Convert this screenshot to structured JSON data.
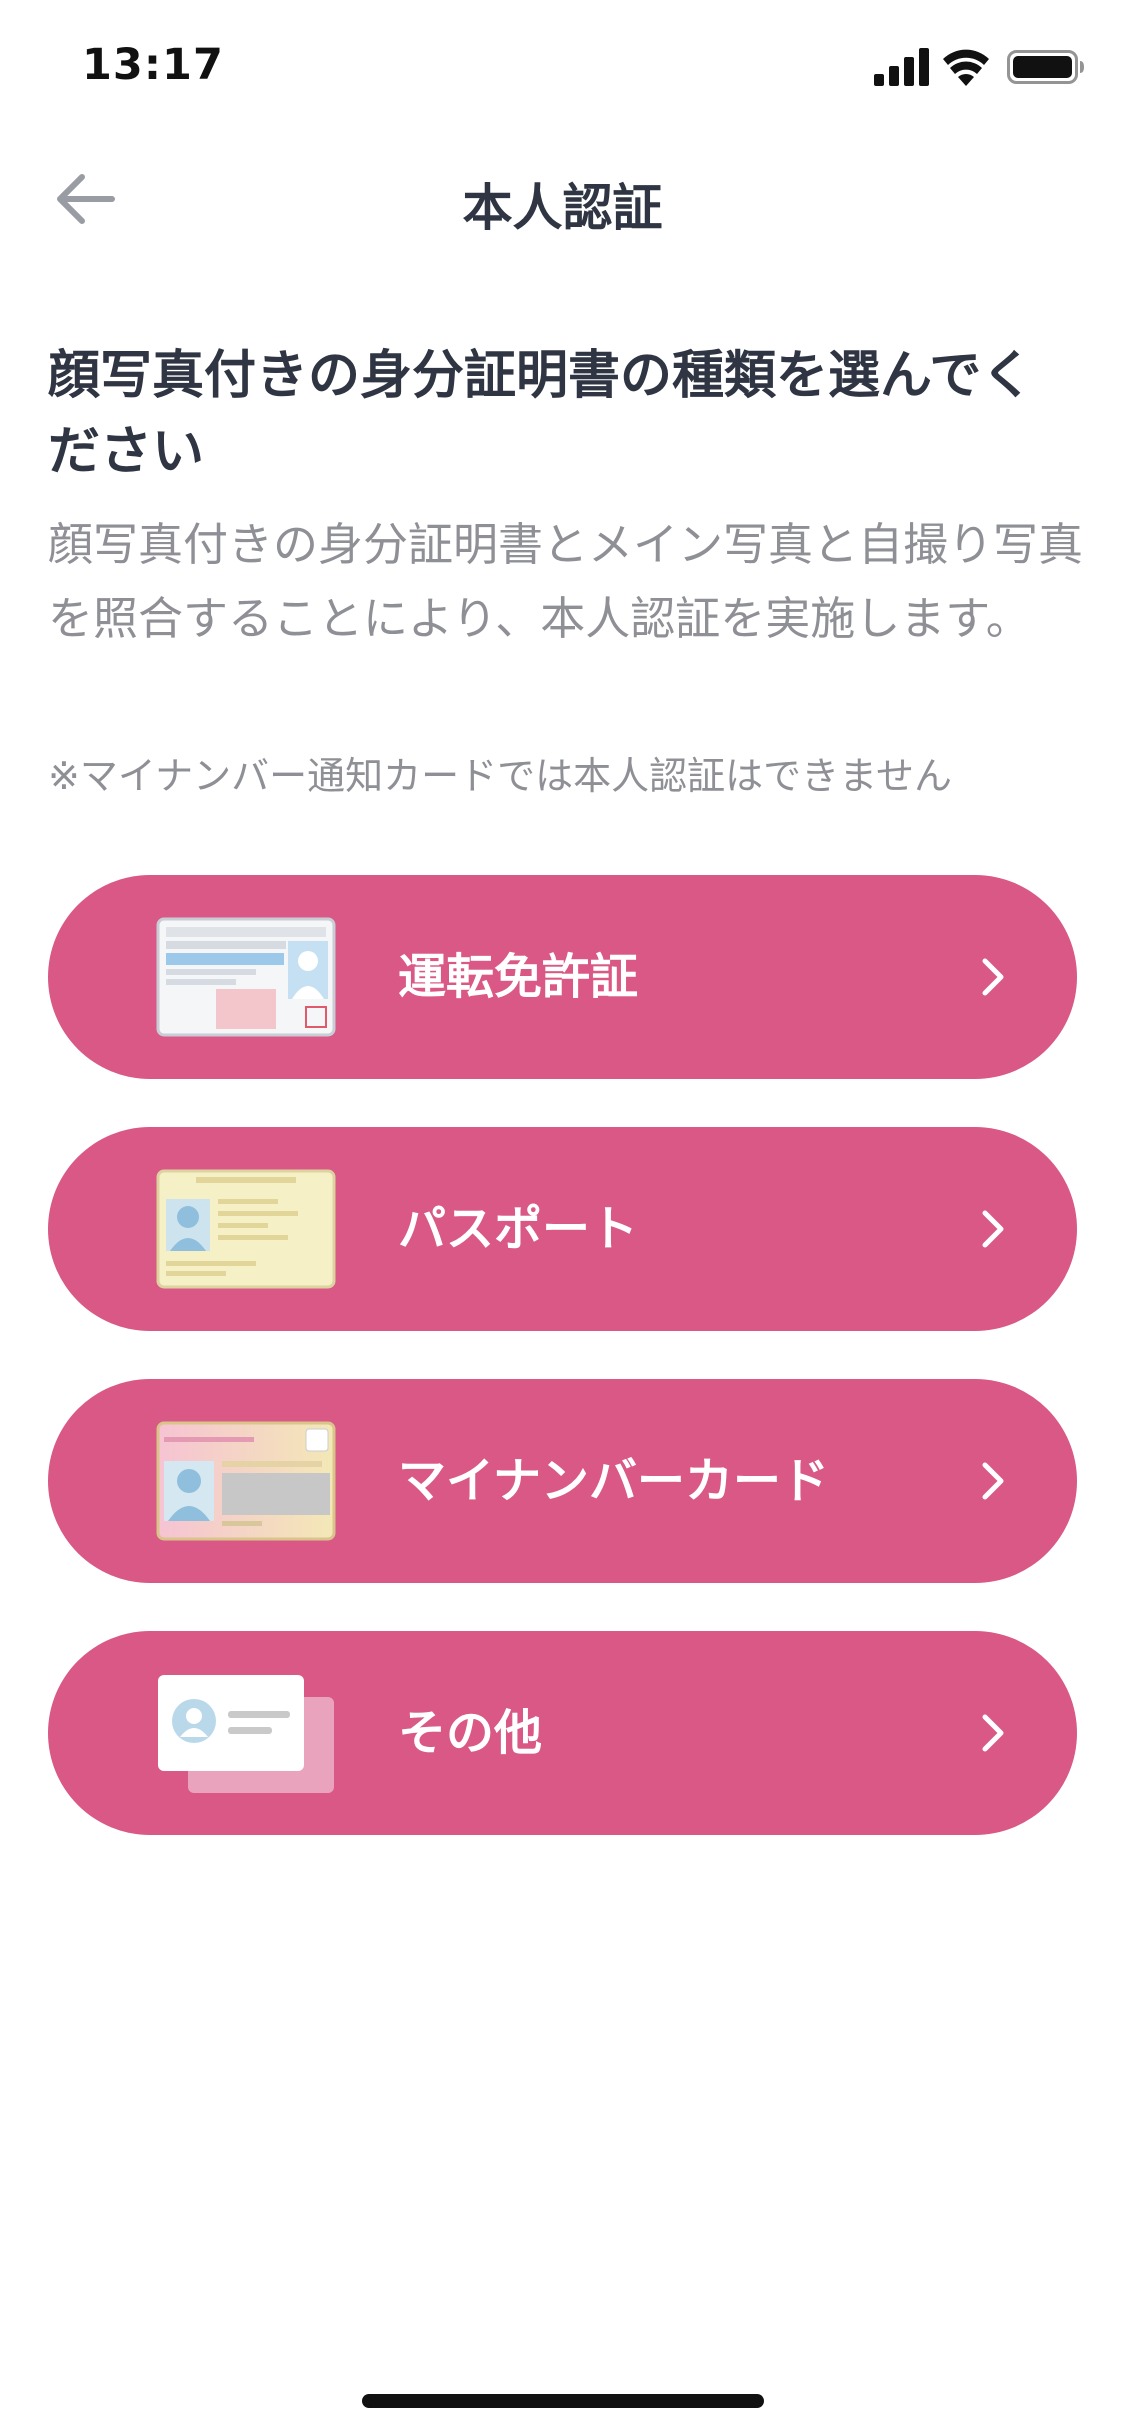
{
  "status_bar": {
    "time": "13:17",
    "icons": [
      "signal-icon",
      "wifi-icon",
      "battery-icon"
    ]
  },
  "nav": {
    "title": "本人認証",
    "back_icon": "arrow-left-icon"
  },
  "content": {
    "heading": "顔写真付きの身分証明書の種類を選んでください",
    "description": "顔写真付きの身分証明書とメイン写真と自撮り写真を照合することにより、本人認証を実施します。",
    "note": "※マイナンバー通知カードでは本人認証はできません"
  },
  "options": [
    {
      "label": "運転免許証",
      "thumb_icon": "drivers-license-icon"
    },
    {
      "label": "パスポート",
      "thumb_icon": "passport-icon"
    },
    {
      "label": "マイナンバーカード",
      "thumb_icon": "my-number-card-icon"
    },
    {
      "label": "その他",
      "thumb_icon": "generic-id-card-icon"
    }
  ],
  "colors": {
    "accent": "#d95885",
    "heading": "#2f3542",
    "muted_text": "#8e9096",
    "background": "#ffffff"
  }
}
